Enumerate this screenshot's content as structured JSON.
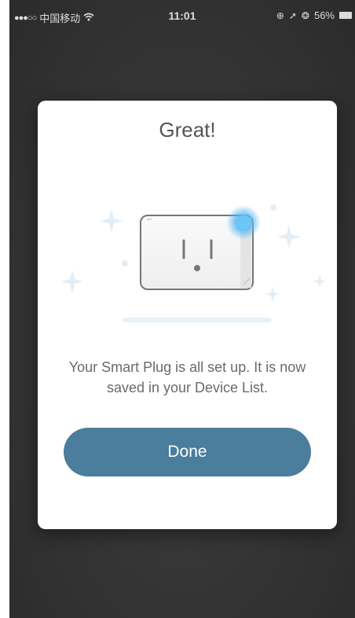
{
  "status_bar": {
    "signal": "●●●○○",
    "carrier": "中国移动",
    "wifi_icon": "wifi-icon",
    "time": "11:01",
    "icons": [
      "lock-rotation-icon",
      "location-icon",
      "alarm-icon"
    ],
    "battery": "56%"
  },
  "modal": {
    "title": "Great!",
    "message": "Your Smart Plug is all set up. It is now saved in your Device List.",
    "done_label": "Done"
  },
  "colors": {
    "accent": "#4b7d9d",
    "glow": "#5ab8f2",
    "sparkle": "#e3edf6"
  }
}
